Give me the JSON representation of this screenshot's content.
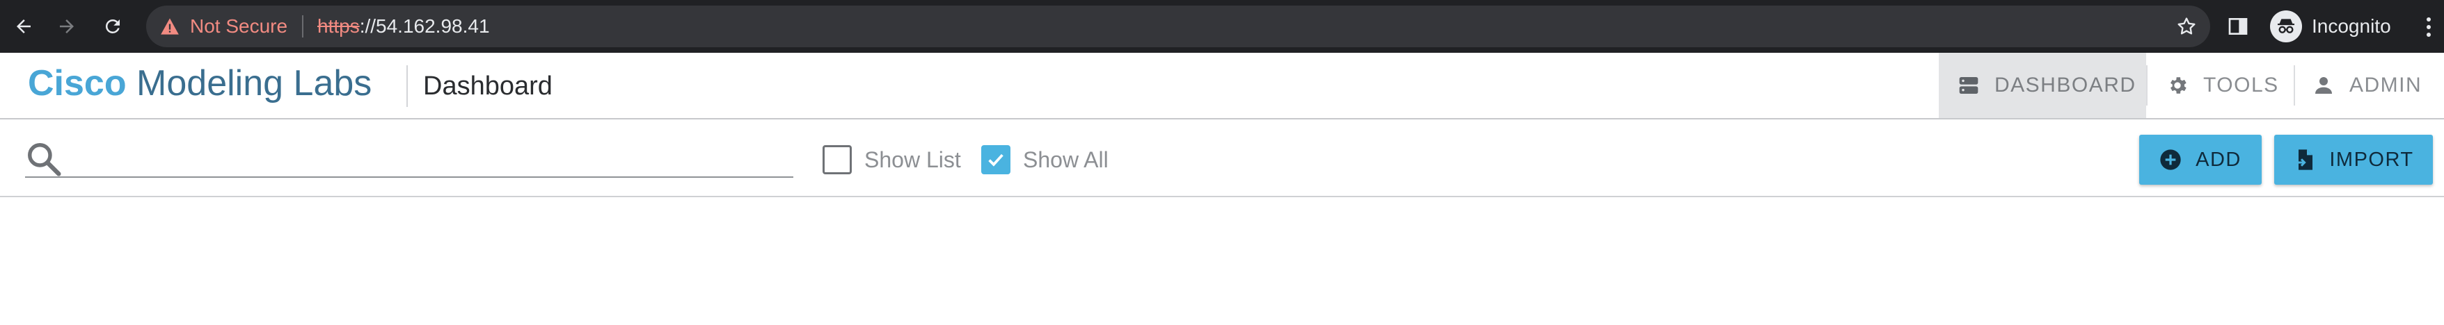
{
  "browser": {
    "security_label": "Not Secure",
    "url_scheme": "https",
    "url_rest": "://54.162.98.41",
    "profile_label": "Incognito"
  },
  "header": {
    "brand_bold": "Cisco",
    "brand_rest": " Modeling Labs",
    "page_title": "Dashboard",
    "nav": [
      {
        "label": "DASHBOARD",
        "icon": "server-icon",
        "active": true
      },
      {
        "label": "TOOLS",
        "icon": "gear-icon",
        "active": false
      },
      {
        "label": "ADMIN",
        "icon": "person-icon",
        "active": false
      }
    ]
  },
  "toolbar": {
    "search_value": "",
    "show_list_label": "Show List",
    "show_list_checked": false,
    "show_all_label": "Show All",
    "show_all_checked": true,
    "add_label": "ADD",
    "import_label": "IMPORT"
  },
  "colors": {
    "accent": "#4ab3e0",
    "brand_blue": "#49a6d6",
    "chrome_bg": "#202124",
    "warning": "#f28b82"
  }
}
